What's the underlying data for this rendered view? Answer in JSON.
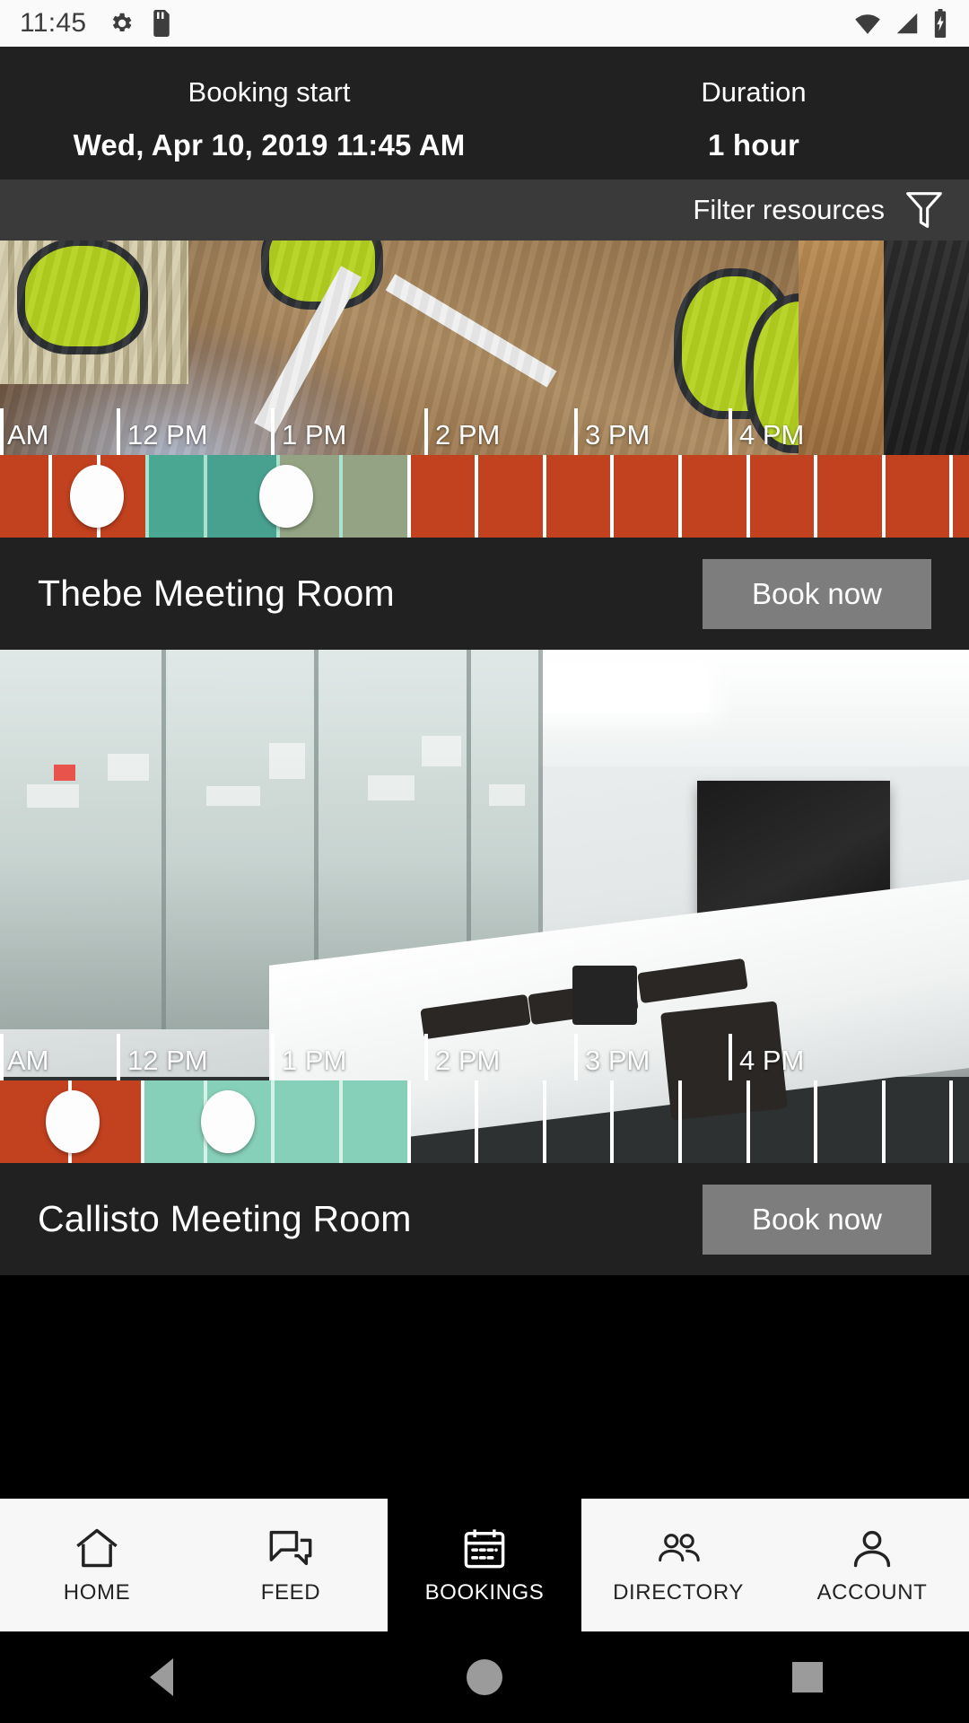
{
  "status_bar": {
    "clock": "11:45",
    "icons": [
      "gear-icon",
      "sd-card-icon",
      "wifi-icon",
      "signal-icon",
      "battery-charging-icon"
    ]
  },
  "booking_header": {
    "start_label": "Booking start",
    "start_value": "Wed, Apr 10, 2019 11:45 AM",
    "duration_label": "Duration",
    "duration_value": "1 hour"
  },
  "filter_bar": {
    "label": "Filter resources",
    "icon": "funnel-icon"
  },
  "colors": {
    "busy": "#c94a2e",
    "busy_alt": "#d2512f",
    "selected_teal": "#4aa892",
    "selected_mint": "#8fd3bd",
    "selected_muted": "#93a383",
    "handle": "#fdfdfd",
    "header_bg": "#212121",
    "filter_bg": "#3a3a3a",
    "button_bg": "#7d7d7d",
    "tabbar_bg": "#f7f7f7",
    "tab_active_bg": "#000000"
  },
  "time_ruler": {
    "labels": [
      "AM",
      "12 PM",
      "1 PM",
      "2 PM",
      "3 PM",
      "4 PM"
    ],
    "positions_pct": [
      0,
      15.0,
      29.0,
      44.0,
      59.0,
      76.0
    ]
  },
  "resources": [
    {
      "name": "Thebe Meeting Room",
      "book_label": "Book now",
      "photo": "conference-table-green-chairs",
      "timeline": {
        "segments": [
          {
            "start_pct": 0,
            "end_pct": 10.0,
            "state": "busy",
            "color": "#c2411f"
          },
          {
            "start_pct": 10.0,
            "end_pct": 15.0,
            "state": "busy",
            "color": "#c2411f"
          },
          {
            "start_pct": 15.0,
            "end_pct": 21.0,
            "state": "selected",
            "color": "#4aa892"
          },
          {
            "start_pct": 21.0,
            "end_pct": 28.5,
            "state": "selected",
            "color": "#48a18f"
          },
          {
            "start_pct": 28.5,
            "end_pct": 35.0,
            "state": "selected",
            "color": "#93a383"
          },
          {
            "start_pct": 35.0,
            "end_pct": 42.0,
            "state": "selected",
            "color": "#93a383"
          },
          {
            "start_pct": 42.0,
            "end_pct": 100,
            "state": "busy",
            "color": "#c2411f"
          }
        ],
        "handles_pct": [
          10.0,
          29.5
        ],
        "slot_lines_pct": [
          5,
          10,
          15,
          21,
          28.5,
          35,
          42,
          49,
          56,
          63,
          70,
          77,
          84,
          91,
          98
        ]
      }
    },
    {
      "name": "Callisto Meeting Room",
      "book_label": "Book now",
      "photo": "glass-wall-conference-room-tv",
      "timeline": {
        "segments": [
          {
            "start_pct": 0,
            "end_pct": 7.0,
            "state": "busy",
            "color": "#c2411f"
          },
          {
            "start_pct": 7.0,
            "end_pct": 14.5,
            "state": "busy",
            "color": "#c2411f"
          },
          {
            "start_pct": 14.5,
            "end_pct": 21.0,
            "state": "selected",
            "color": "#86cfb8"
          },
          {
            "start_pct": 21.0,
            "end_pct": 28.0,
            "state": "selected",
            "color": "#86cfb8"
          },
          {
            "start_pct": 28.0,
            "end_pct": 35.0,
            "state": "selected",
            "color": "#86cfb8"
          },
          {
            "start_pct": 35.0,
            "end_pct": 42.0,
            "state": "selected",
            "color": "#86cfb8"
          },
          {
            "start_pct": 42.0,
            "end_pct": 100,
            "state": "available",
            "color": "transparent"
          }
        ],
        "handles_pct": [
          7.5,
          23.5
        ],
        "slot_lines_pct": [
          7,
          14.5,
          21,
          28,
          35,
          42,
          49,
          56,
          63,
          70,
          77,
          84,
          91,
          98
        ]
      }
    }
  ],
  "tab_bar": {
    "tabs": [
      {
        "label": "HOME",
        "icon": "home-icon",
        "active": false
      },
      {
        "label": "FEED",
        "icon": "chat-icon",
        "active": false
      },
      {
        "label": "BOOKINGS",
        "icon": "calendar-icon",
        "active": true
      },
      {
        "label": "DIRECTORY",
        "icon": "people-icon",
        "active": false
      },
      {
        "label": "ACCOUNT",
        "icon": "person-icon",
        "active": false
      }
    ]
  },
  "nav_bar": {
    "buttons": [
      "back-triangle-icon",
      "home-circle-icon",
      "recents-square-icon"
    ]
  }
}
